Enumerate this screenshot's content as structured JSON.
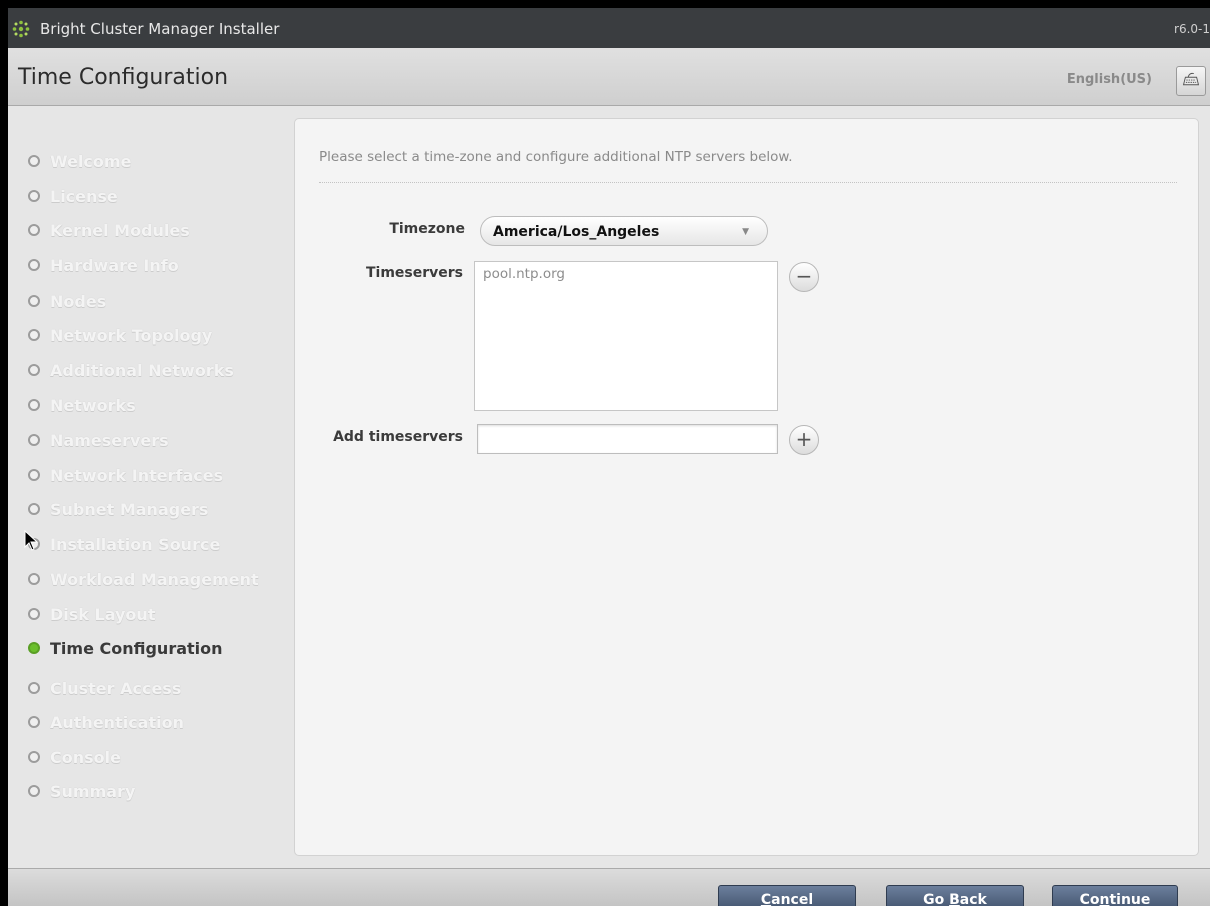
{
  "titlebar": {
    "title": "Bright Cluster Manager Installer",
    "version": "r6.0-1"
  },
  "header": {
    "page_title": "Time Configuration",
    "language": "English(US)",
    "keyboard_icon": "keyboard-icon"
  },
  "sidebar": {
    "steps": [
      {
        "label": "Welcome"
      },
      {
        "label": "License"
      },
      {
        "label": "Kernel Modules"
      },
      {
        "label": "Hardware Info"
      },
      {
        "label": "Nodes"
      },
      {
        "label": "Network Topology"
      },
      {
        "label": "Additional Networks"
      },
      {
        "label": "Networks"
      },
      {
        "label": "Nameservers"
      },
      {
        "label": "Network Interfaces"
      },
      {
        "label": "Subnet Managers"
      },
      {
        "label": "Installation Source"
      },
      {
        "label": "Workload Management"
      },
      {
        "label": "Disk Layout"
      },
      {
        "label": "Time Configuration",
        "active": true
      },
      {
        "label": "Cluster Access"
      },
      {
        "label": "Authentication"
      },
      {
        "label": "Console"
      },
      {
        "label": "Summary"
      }
    ]
  },
  "content": {
    "intro": "Please select a time-zone and configure additional NTP servers below.",
    "timezone_label": "Timezone",
    "timezone_value": "America/Los_Angeles",
    "timeservers_label": "Timeservers",
    "timeservers": [
      "pool.ntp.org"
    ],
    "add_label": "Add timeservers",
    "add_value": "",
    "remove_symbol": "−",
    "add_symbol": "+"
  },
  "footer": {
    "cancel": {
      "pre": "",
      "mnemonic": "C",
      "post": "ancel"
    },
    "goback": {
      "pre": "Go ",
      "mnemonic": "B",
      "post": "ack"
    },
    "continue": {
      "pre": "Co",
      "mnemonic": "n",
      "post": "tinue"
    }
  },
  "colors": {
    "active_dot": "#6bbf2c",
    "button": "#4a5b77",
    "titlebar": "#3a3d40"
  }
}
